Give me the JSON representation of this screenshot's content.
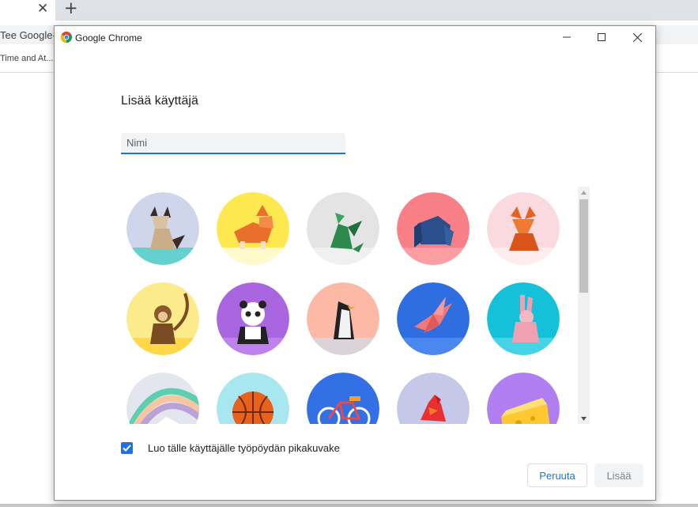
{
  "background_browser": {
    "tab_close_glyph": "✕",
    "new_tab_glyph": "+",
    "omnibox_text": "Tee Google-",
    "bookmark_text": "Time and At..."
  },
  "window": {
    "title": "Google Chrome"
  },
  "dialog": {
    "heading": "Lisää käyttäjä",
    "name_placeholder": "Nimi",
    "name_value": "",
    "checkbox_label": "Luo tälle käyttäjälle työpöydän pikakuvake",
    "checkbox_checked": true,
    "cancel_label": "Peruuta",
    "add_label": "Lisää"
  },
  "avatars": [
    {
      "icon": "cat-avatar-icon",
      "bg": "#cfd6ec",
      "accent": "#50d0c8"
    },
    {
      "icon": "corgi-avatar-icon",
      "bg": "#fde94f",
      "accent": "#fffbe0"
    },
    {
      "icon": "dragon-avatar-icon",
      "bg": "#e4e4e4",
      "accent": "#f2f2f2"
    },
    {
      "icon": "elephant-avatar-icon",
      "bg": "#f87f86",
      "accent": "#fca2a8"
    },
    {
      "icon": "fox-avatar-icon",
      "bg": "#fbdadf",
      "accent": "#ffeef1"
    },
    {
      "icon": "monkey-avatar-icon",
      "bg": "#fceb8a",
      "accent": "#ffd43d"
    },
    {
      "icon": "panda-avatar-icon",
      "bg": "#a966e0",
      "accent": "#c187ee"
    },
    {
      "icon": "penguin-avatar-icon",
      "bg": "#fcb9a5",
      "accent": "#d6d7e0"
    },
    {
      "icon": "bird-avatar-icon",
      "bg": "#2f6ee0",
      "accent": "#4f8df2"
    },
    {
      "icon": "rabbit-avatar-icon",
      "bg": "#14c1d8",
      "accent": "#4fd6e6"
    },
    {
      "icon": "unicorn-avatar-icon",
      "bg": "#e3e6ee",
      "accent": "#b8a2d8"
    },
    {
      "icon": "basketball-avatar-icon",
      "bg": "#a8e7f0",
      "accent": "#d0f4f8"
    },
    {
      "icon": "bike-avatar-icon",
      "bg": "#3370e6",
      "accent": "#5b8ff0"
    },
    {
      "icon": "cardinal-avatar-icon",
      "bg": "#c6c8ea",
      "accent": "#dfe0f4"
    },
    {
      "icon": "cheese-avatar-icon",
      "bg": "#b07ef0",
      "accent": "#c89ff4"
    }
  ],
  "colors": {
    "accent": "#1a73e8",
    "scroll_thumb": "#c1c1c1"
  }
}
